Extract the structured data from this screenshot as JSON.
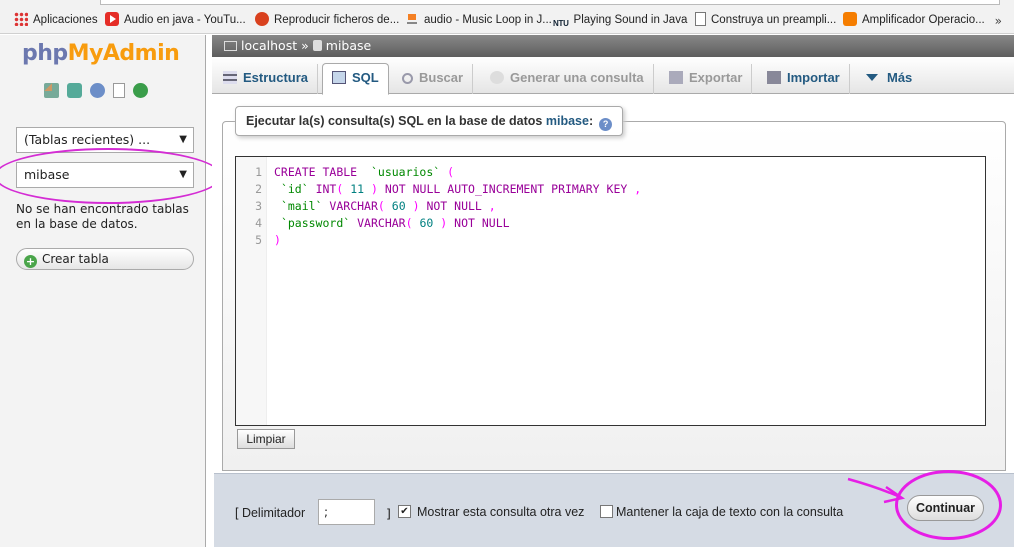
{
  "bookmarks": [
    {
      "label": "Aplicaciones",
      "icon": "apps-grid-icon"
    },
    {
      "label": "Audio en java - YouTu...",
      "icon": "youtube-icon"
    },
    {
      "label": "Reproducir ficheros de...",
      "icon": "site-favicon-icon"
    },
    {
      "label": "audio - Music Loop in J...",
      "icon": "stackoverflow-icon"
    },
    {
      "label": "Playing Sound in Java",
      "icon": "ntu-icon",
      "prefix": "NTU"
    },
    {
      "label": "Construya un preampli...",
      "icon": "document-icon"
    },
    {
      "label": "Amplificador Operacio...",
      "icon": "blogger-icon"
    }
  ],
  "bookmarks_more": "»",
  "sidebar": {
    "logo": {
      "php": "php",
      "my": "My",
      "admin": "Admin"
    },
    "recent_tables": "(Tablas recientes) ...",
    "database_select": "mibase",
    "no_tables_msg": "No se han encontrado tablas en la base de datos.",
    "create_table": "Crear tabla"
  },
  "breadcrumb": {
    "server": "localhost",
    "separator": "»",
    "database": "mibase"
  },
  "tabs": [
    {
      "label": "Estructura",
      "state": "normal"
    },
    {
      "label": "SQL",
      "state": "active"
    },
    {
      "label": "Buscar",
      "state": "disabled"
    },
    {
      "label": "Generar una consulta",
      "state": "disabled"
    },
    {
      "label": "Exportar",
      "state": "disabled"
    },
    {
      "label": "Importar",
      "state": "normal"
    },
    {
      "label": "Más",
      "state": "normal"
    }
  ],
  "sql_panel": {
    "legend_prefix": "Ejecutar la(s) consulta(s) SQL en la base de datos",
    "legend_db": "mibase",
    "legend_suffix": ":",
    "line_numbers": [
      "1",
      "2",
      "3",
      "4",
      "5"
    ],
    "code_lines": [
      "CREATE TABLE  `usuarios` (",
      " `id` INT( 11 ) NOT NULL AUTO_INCREMENT PRIMARY KEY ,",
      " `mail` VARCHAR( 60 ) NOT NULL ,",
      " `password` VARCHAR( 60 ) NOT NULL",
      ")"
    ],
    "clear_button": "Limpiar"
  },
  "footer": {
    "delimiter_label": "[ Delimitador",
    "delimiter_value": ";",
    "delimiter_close": "]",
    "show_query_again": {
      "label": "Mostrar esta consulta otra vez",
      "checked": true
    },
    "retain_box": {
      "label": "Mantener la caja de texto con la consulta",
      "checked": false
    },
    "submit": "Continuar"
  },
  "colors": {
    "annotation": "#e61ee6",
    "link_blue": "#235a81",
    "sql_keyword": "#990099",
    "sql_identifier": "#008800"
  }
}
